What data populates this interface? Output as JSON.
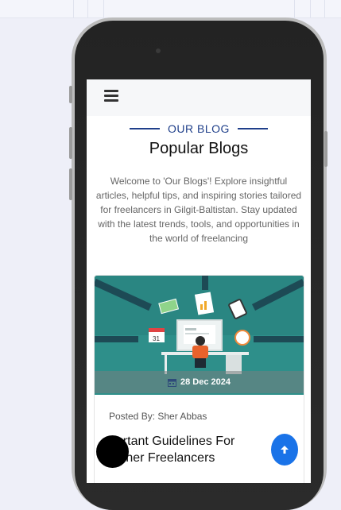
{
  "header": {
    "eyebrow": "OUR BLOG",
    "title": "Popular Blogs",
    "intro": "Welcome to 'Our Blogs'! Explore insightful articles, helpful tips, and inspiring stories tailored for freelancers in Gilgit-Baltistan. Stay updated with the latest trends, tools, and opportunities in the world of freelancing"
  },
  "card": {
    "date": "28 Dec 2024",
    "posted_by": "Posted By: Sher Abbas",
    "title_visible": "portant Guidelines For\nginner Freelancers"
  },
  "colors": {
    "accent": "#1f3f8a",
    "fab_blue": "#1a73e8",
    "image_bg": "#2e8f8a"
  },
  "icons": [
    "hamburger-menu-icon",
    "calendar-icon",
    "arrow-up-icon"
  ]
}
